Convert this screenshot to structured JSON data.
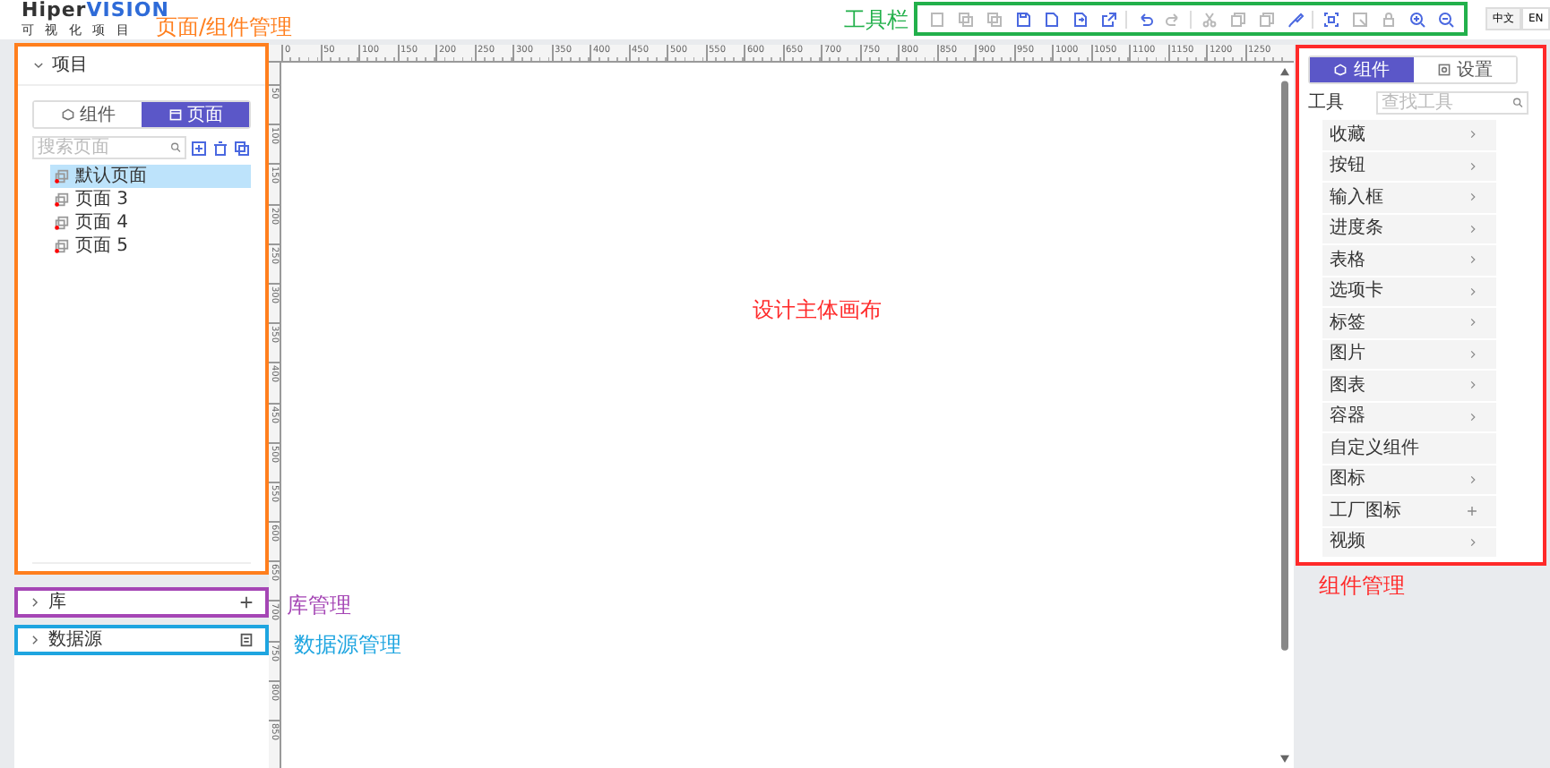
{
  "header": {
    "logo_part1": "Hiper",
    "logo_part2": "VISION",
    "logo_subtitle": "可 视 化 项 目"
  },
  "toolbar": {
    "annotation": {
      "label": "工具栏",
      "color": "#22b04b"
    },
    "buttons": [
      {
        "disabled": true
      },
      {
        "disabled": true
      },
      {
        "disabled": true
      },
      {
        "disabled": false
      },
      {
        "disabled": false
      },
      {
        "disabled": false
      },
      {
        "disabled": false
      },
      {
        "disabled": false
      },
      {
        "disabled": true
      },
      {
        "disabled": true
      },
      {
        "disabled": true
      },
      {
        "disabled": true
      },
      {
        "disabled": false
      },
      {
        "disabled": false
      },
      {
        "disabled": true
      },
      {
        "disabled": true
      },
      {
        "disabled": false
      },
      {
        "disabled": false
      }
    ],
    "languages": [
      {
        "label": "中文",
        "selected": true
      },
      {
        "label": "EN",
        "selected": false
      }
    ]
  },
  "left_panel": {
    "annotation": {
      "label": "页面/组件管理",
      "color": "#ff7f1e"
    },
    "section": {
      "title": "项目",
      "expanded": true
    },
    "tabs": [
      {
        "label": "组件",
        "selected": false
      },
      {
        "label": "页面",
        "selected": true
      }
    ],
    "search": {
      "placeholder": "搜索页面"
    },
    "pages": [
      {
        "label": "默认页面",
        "selected": true
      },
      {
        "label": "页面 3",
        "selected": false
      },
      {
        "label": "页面 4",
        "selected": false
      },
      {
        "label": "页面 5",
        "selected": false
      }
    ]
  },
  "library": {
    "annotation": {
      "label": "库管理",
      "color": "#a546b5"
    },
    "title": "库",
    "expanded": false
  },
  "datasource": {
    "annotation": {
      "label": "数据源管理",
      "color": "#1ea5e0"
    },
    "title": "数据源",
    "expanded": false
  },
  "canvas": {
    "annotation": {
      "label": "设计主体画布",
      "color": "#ff2a2a"
    },
    "top_ruler": [
      "0",
      "50",
      "100",
      "150",
      "200",
      "250",
      "300",
      "350",
      "400",
      "450",
      "500",
      "550",
      "600",
      "650",
      "700",
      "750",
      "800",
      "850",
      "900",
      "950",
      "1000",
      "1050",
      "1100",
      "1150",
      "1200",
      "1250"
    ],
    "left_ruler": [
      "50",
      "100",
      "150",
      "200",
      "250",
      "300",
      "350",
      "400",
      "450",
      "500",
      "550",
      "600",
      "650",
      "700",
      "750",
      "800",
      "850"
    ]
  },
  "right_panel": {
    "annotation": {
      "label": "组件管理",
      "color": "#ff2a2a"
    },
    "tabs": [
      {
        "label": "组件",
        "selected": true
      },
      {
        "label": "设置",
        "selected": false
      }
    ],
    "tool_label": "工具",
    "search": {
      "placeholder": "查找工具"
    },
    "items": [
      {
        "label": "收藏",
        "kind": "arrow"
      },
      {
        "label": "按钮",
        "kind": "arrow"
      },
      {
        "label": "输入框",
        "kind": "arrow"
      },
      {
        "label": "进度条",
        "kind": "arrow"
      },
      {
        "label": "表格",
        "kind": "arrow"
      },
      {
        "label": "选项卡",
        "kind": "arrow"
      },
      {
        "label": "标签",
        "kind": "arrow"
      },
      {
        "label": "图片",
        "kind": "arrow"
      },
      {
        "label": "图表",
        "kind": "arrow"
      },
      {
        "label": "容器",
        "kind": "arrow"
      },
      {
        "label": "自定义组件",
        "kind": "plain"
      },
      {
        "label": "图标",
        "kind": "arrow"
      },
      {
        "label": "工厂图标",
        "kind": "plus"
      },
      {
        "label": "视频",
        "kind": "arrow"
      }
    ]
  }
}
